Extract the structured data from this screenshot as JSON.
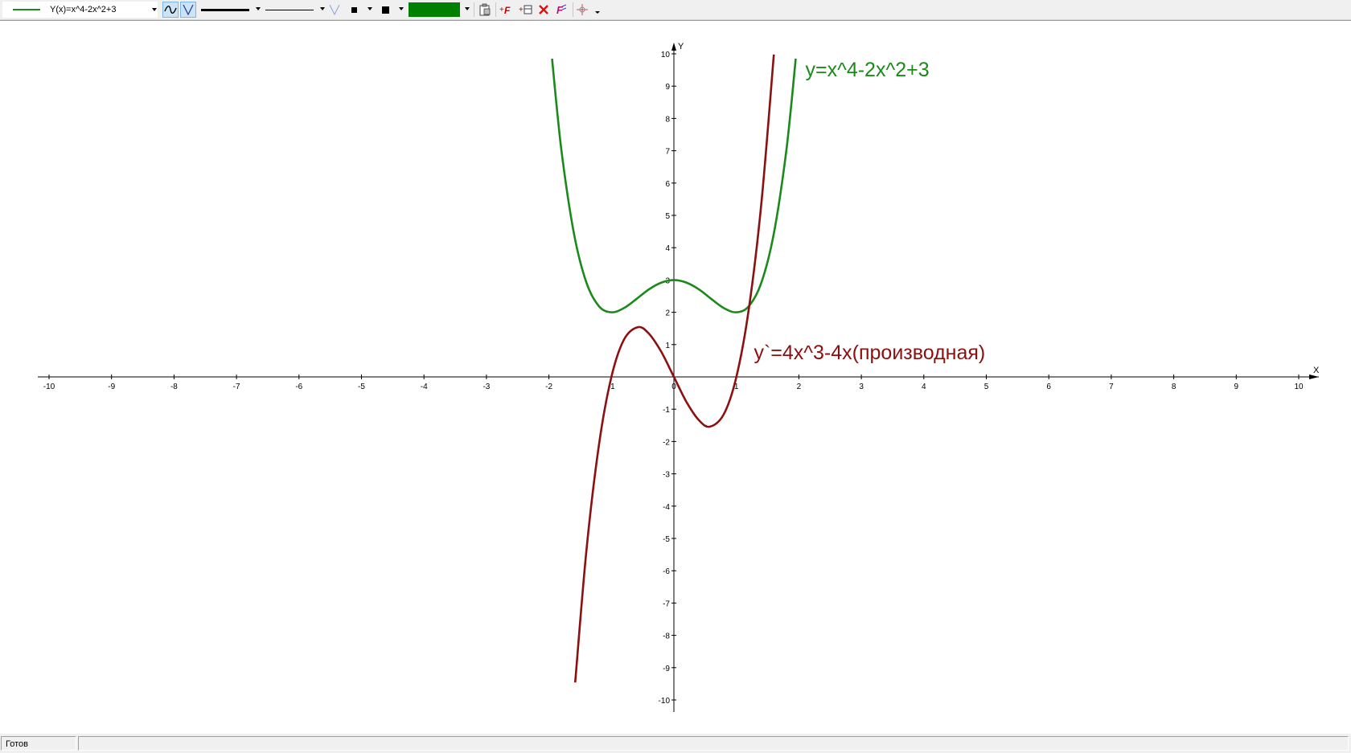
{
  "toolbar": {
    "function_selector": "Y(x)=x^4-2x^2+3",
    "function_color": "#1a8a1a",
    "fill_color": "#008000"
  },
  "status": {
    "text": "Готов"
  },
  "chart_data": {
    "type": "line",
    "xlabel": "X",
    "ylabel": "Y",
    "xlim": [
      -10,
      10
    ],
    "ylim": [
      -10,
      10
    ],
    "x_ticks": [
      -10,
      -9,
      -8,
      -7,
      -6,
      -5,
      -4,
      -3,
      -2,
      -1,
      0,
      1,
      2,
      3,
      4,
      5,
      6,
      7,
      8,
      9,
      10
    ],
    "y_ticks": [
      -10,
      -9,
      -8,
      -7,
      -6,
      -5,
      -4,
      -3,
      -2,
      -1,
      1,
      2,
      3,
      4,
      5,
      6,
      7,
      8,
      9,
      10
    ],
    "grid": false,
    "series": [
      {
        "label": "y=x^4-2x^2+3",
        "color": "#1a8a1a",
        "x": [
          -1.95,
          -1.8,
          -1.6,
          -1.4,
          -1.2,
          -1.0,
          -0.8,
          -0.6,
          -0.4,
          -0.2,
          0.0,
          0.2,
          0.4,
          0.6,
          0.8,
          1.0,
          1.2,
          1.4,
          1.6,
          1.8,
          1.95
        ],
        "y": [
          9.85,
          7.02,
          4.44,
          2.92,
          2.19,
          2.0,
          2.13,
          2.41,
          2.71,
          2.92,
          3.0,
          2.92,
          2.71,
          2.41,
          2.13,
          2.0,
          2.19,
          2.92,
          4.44,
          7.02,
          9.85
        ]
      },
      {
        "label": "y`=4x^3-4x(производная)",
        "color": "#8b1010",
        "x": [
          -1.58,
          -1.4,
          -1.2,
          -1.0,
          -0.8,
          -0.577,
          -0.4,
          -0.2,
          0.0,
          0.2,
          0.4,
          0.577,
          0.8,
          1.0,
          1.2,
          1.4,
          1.6
        ],
        "y": [
          -9.46,
          -5.38,
          -2.11,
          0.0,
          1.15,
          1.54,
          1.34,
          0.77,
          0.0,
          -0.77,
          -1.34,
          -1.54,
          -1.15,
          0.0,
          2.11,
          5.38,
          9.98
        ]
      }
    ]
  }
}
